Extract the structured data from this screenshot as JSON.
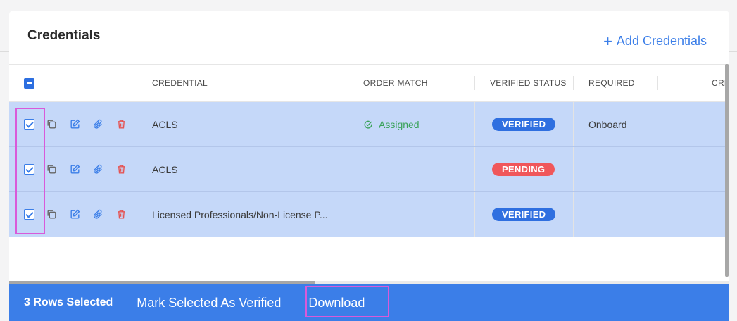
{
  "card": {
    "title": "Credentials",
    "add_button_label": "Add Credentials"
  },
  "table": {
    "headers": {
      "credential": "CREDENTIAL",
      "order_match": "ORDER MATCH",
      "verified_status": "VERIFIED STATUS",
      "required": "REQUIRED",
      "next_col": "CRE"
    },
    "rows": [
      {
        "selected": true,
        "credential": "ACLS",
        "order_match": "Assigned",
        "verified_status": "VERIFIED",
        "required": "Onboard"
      },
      {
        "selected": true,
        "credential": "ACLS",
        "order_match": "",
        "verified_status": "PENDING",
        "required": ""
      },
      {
        "selected": true,
        "credential": "Licensed Professionals/Non-License P...",
        "order_match": "",
        "verified_status": "VERIFIED",
        "required": ""
      }
    ]
  },
  "footer": {
    "selected_count": "3 Rows Selected",
    "mark_verified_label": "Mark Selected As Verified",
    "download_label": "Download"
  },
  "colors": {
    "accent": "#3b7ee8",
    "verified": "#2f6fe0",
    "pending": "#f0575b",
    "assigned": "#3aa25a",
    "selected_row": "#c5d8f9",
    "highlight": "#d95ad9"
  }
}
